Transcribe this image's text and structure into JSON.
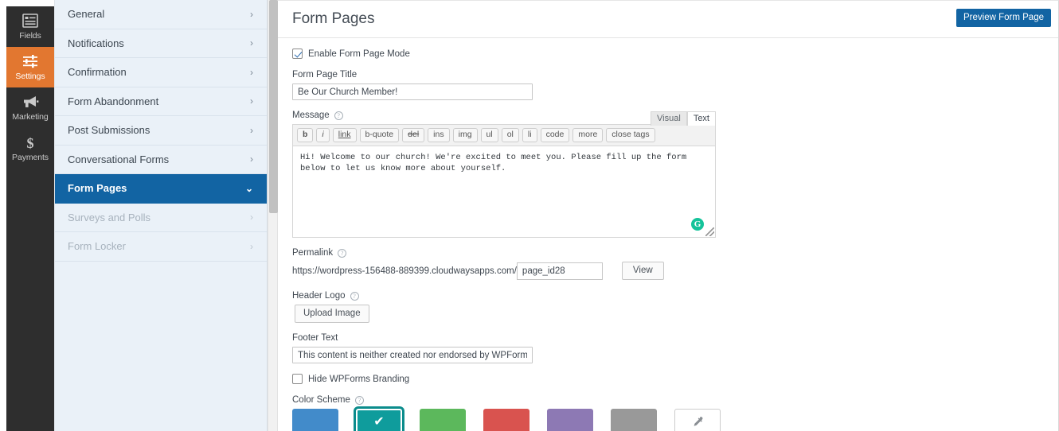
{
  "rail": {
    "items": [
      {
        "label": "Fields",
        "icon": "form-fields-icon",
        "active": false
      },
      {
        "label": "Settings",
        "icon": "sliders-icon",
        "active": true
      },
      {
        "label": "Marketing",
        "icon": "megaphone-icon",
        "active": false
      },
      {
        "label": "Payments",
        "icon": "dollar-icon",
        "active": false
      }
    ],
    "active_color": "#e27730"
  },
  "settings_menu": {
    "items": [
      {
        "label": "General",
        "state": "normal",
        "chevron": "›"
      },
      {
        "label": "Notifications",
        "state": "normal",
        "chevron": "›"
      },
      {
        "label": "Confirmation",
        "state": "normal",
        "chevron": "›"
      },
      {
        "label": "Form Abandonment",
        "state": "normal",
        "chevron": "›"
      },
      {
        "label": "Post Submissions",
        "state": "normal",
        "chevron": "›"
      },
      {
        "label": "Conversational Forms",
        "state": "normal",
        "chevron": "›"
      },
      {
        "label": "Form Pages",
        "state": "active",
        "chevron": "⌄"
      },
      {
        "label": "Surveys and Polls",
        "state": "disabled",
        "chevron": "›"
      },
      {
        "label": "Form Locker",
        "state": "disabled",
        "chevron": "›"
      }
    ],
    "active_color": "#1264a3"
  },
  "header": {
    "title": "Form Pages",
    "preview_button": "Preview Form Page"
  },
  "form": {
    "enable_mode": {
      "label": "Enable Form Page Mode",
      "checked": true
    },
    "page_title": {
      "label": "Form Page Title",
      "value": "Be Our Church Member!",
      "placeholder": ""
    },
    "message": {
      "label": "Message",
      "help": "?",
      "tabs": [
        {
          "label": "Visual",
          "active": false
        },
        {
          "label": "Text",
          "active": true
        }
      ],
      "toolbar": [
        {
          "label": "b",
          "style": "bold"
        },
        {
          "label": "i",
          "style": "italic"
        },
        {
          "label": "link",
          "style": "underline"
        },
        {
          "label": "b-quote",
          "style": "plain"
        },
        {
          "label": "del",
          "style": "strike"
        },
        {
          "label": "ins",
          "style": "plain"
        },
        {
          "label": "img",
          "style": "plain"
        },
        {
          "label": "ul",
          "style": "plain"
        },
        {
          "label": "ol",
          "style": "plain"
        },
        {
          "label": "li",
          "style": "plain"
        },
        {
          "label": "code",
          "style": "plain"
        },
        {
          "label": "more",
          "style": "plain"
        },
        {
          "label": "close tags",
          "style": "plain"
        }
      ],
      "content": "Hi! Welcome to our church! We're excited to meet you. Please fill up the form below to let us know more about yourself.",
      "grammarly_badge": "G"
    },
    "permalink": {
      "label": "Permalink",
      "help": "?",
      "base_url": "https://wordpress-156488-889399.cloudwaysapps.com/",
      "slug": "page_id28",
      "view_button": "View"
    },
    "header_logo": {
      "label": "Header Logo",
      "help": "?",
      "upload_button": "Upload Image"
    },
    "footer_text": {
      "label": "Footer Text",
      "value": "This content is neither created nor endorsed by WPForms."
    },
    "hide_branding": {
      "label": "Hide WPForms Branding",
      "checked": false
    },
    "color_scheme": {
      "label": "Color Scheme",
      "help": "?",
      "swatches": [
        {
          "name": "blue",
          "color": "#428bca",
          "selected": false
        },
        {
          "name": "teal",
          "color": "#0f9c9c",
          "selected": true
        },
        {
          "name": "green",
          "color": "#5cb85c",
          "selected": false
        },
        {
          "name": "red",
          "color": "#d9534f",
          "selected": false
        },
        {
          "name": "purple",
          "color": "#8d79b4",
          "selected": false
        },
        {
          "name": "gray",
          "color": "#999999",
          "selected": false
        }
      ],
      "picker_icon": "eyedropper-icon",
      "check_glyph": "✔"
    }
  }
}
